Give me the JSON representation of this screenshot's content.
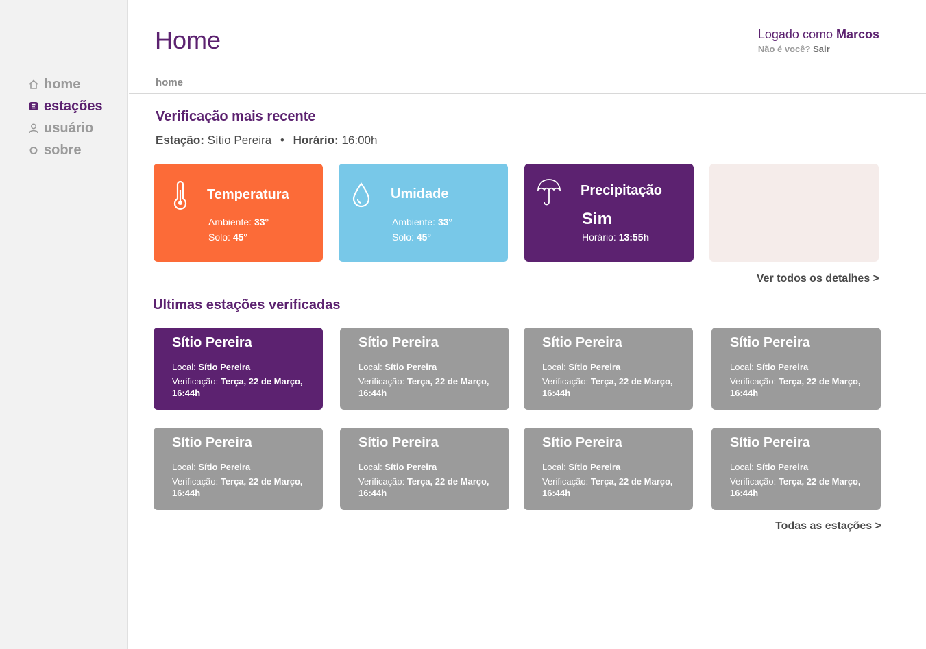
{
  "sidebar": {
    "items": [
      {
        "label": "home",
        "icon": "home-icon",
        "active": false
      },
      {
        "label": "estações",
        "icon": "station-icon",
        "active": true
      },
      {
        "label": "usuário",
        "icon": "user-icon",
        "active": false
      },
      {
        "label": "sobre",
        "icon": "info-circle-icon",
        "active": false
      }
    ]
  },
  "header": {
    "title": "Home",
    "logged_prefix": "Logado como ",
    "user_name": "Marcos",
    "not_you": "Não é você? ",
    "logout": "Sair"
  },
  "breadcrumb": "home",
  "recent": {
    "title": "Verificação mais recente",
    "station_label": "Estação:",
    "station_value": "Sítio Pereira",
    "separator": "•",
    "time_label": "Horário:",
    "time_value": "16:00h",
    "cards": {
      "temperature": {
        "title": "Temperatura",
        "ambient_label": "Ambiente: ",
        "ambient_value": "33°",
        "soil_label": "Solo: ",
        "soil_value": "45°",
        "color": "#fc6b38"
      },
      "humidity": {
        "title": "Umidade",
        "ambient_label": "Ambiente: ",
        "ambient_value": "33°",
        "soil_label": "Solo: ",
        "soil_value": "45°",
        "color": "#78c8e8"
      },
      "precipitation": {
        "title": "Precipitação",
        "value": "Sim",
        "time_label": "Horário: ",
        "time_value": "13:55h",
        "color": "#5c2270"
      },
      "empty_color": "#f5ecea"
    },
    "details_link": "Ver todos os detalhes >"
  },
  "latest": {
    "title": "Ultimas estações verificadas",
    "cards": [
      {
        "name": "Sítio Pereira",
        "local_label": "Local: ",
        "local_value": "Sítio Pereira",
        "verif_label": "Verificação: ",
        "verif_value": "Terça, 22 de Março, 16:44h"
      },
      {
        "name": "Sítio Pereira",
        "local_label": "Local: ",
        "local_value": "Sítio Pereira",
        "verif_label": "Verificação: ",
        "verif_value": "Terça, 22 de Março, 16:44h"
      },
      {
        "name": "Sítio Pereira",
        "local_label": "Local: ",
        "local_value": "Sítio Pereira",
        "verif_label": "Verificação: ",
        "verif_value": "Terça, 22 de Março, 16:44h"
      },
      {
        "name": "Sítio Pereira",
        "local_label": "Local: ",
        "local_value": "Sítio Pereira",
        "verif_label": "Verificação: ",
        "verif_value": "Terça, 22 de Março, 16:44h"
      },
      {
        "name": "Sítio Pereira",
        "local_label": "Local: ",
        "local_value": "Sítio Pereira",
        "verif_label": "Verificação: ",
        "verif_value": "Terça, 22 de Março, 16:44h"
      },
      {
        "name": "Sítio Pereira",
        "local_label": "Local: ",
        "local_value": "Sítio Pereira",
        "verif_label": "Verificação: ",
        "verif_value": "Terça, 22 de Março, 16:44h"
      },
      {
        "name": "Sítio Pereira",
        "local_label": "Local: ",
        "local_value": "Sítio Pereira",
        "verif_label": "Verificação: ",
        "verif_value": "Terça, 22 de Março, 16:44h"
      },
      {
        "name": "Sítio Pereira",
        "local_label": "Local: ",
        "local_value": "Sítio Pereira",
        "verif_label": "Verificação: ",
        "verif_value": "Terça, 22 de Março, 16:44h"
      }
    ],
    "all_link": "Todas as estações >"
  },
  "colors": {
    "brand": "#5c2270",
    "card_gray": "#9b9b9b"
  }
}
